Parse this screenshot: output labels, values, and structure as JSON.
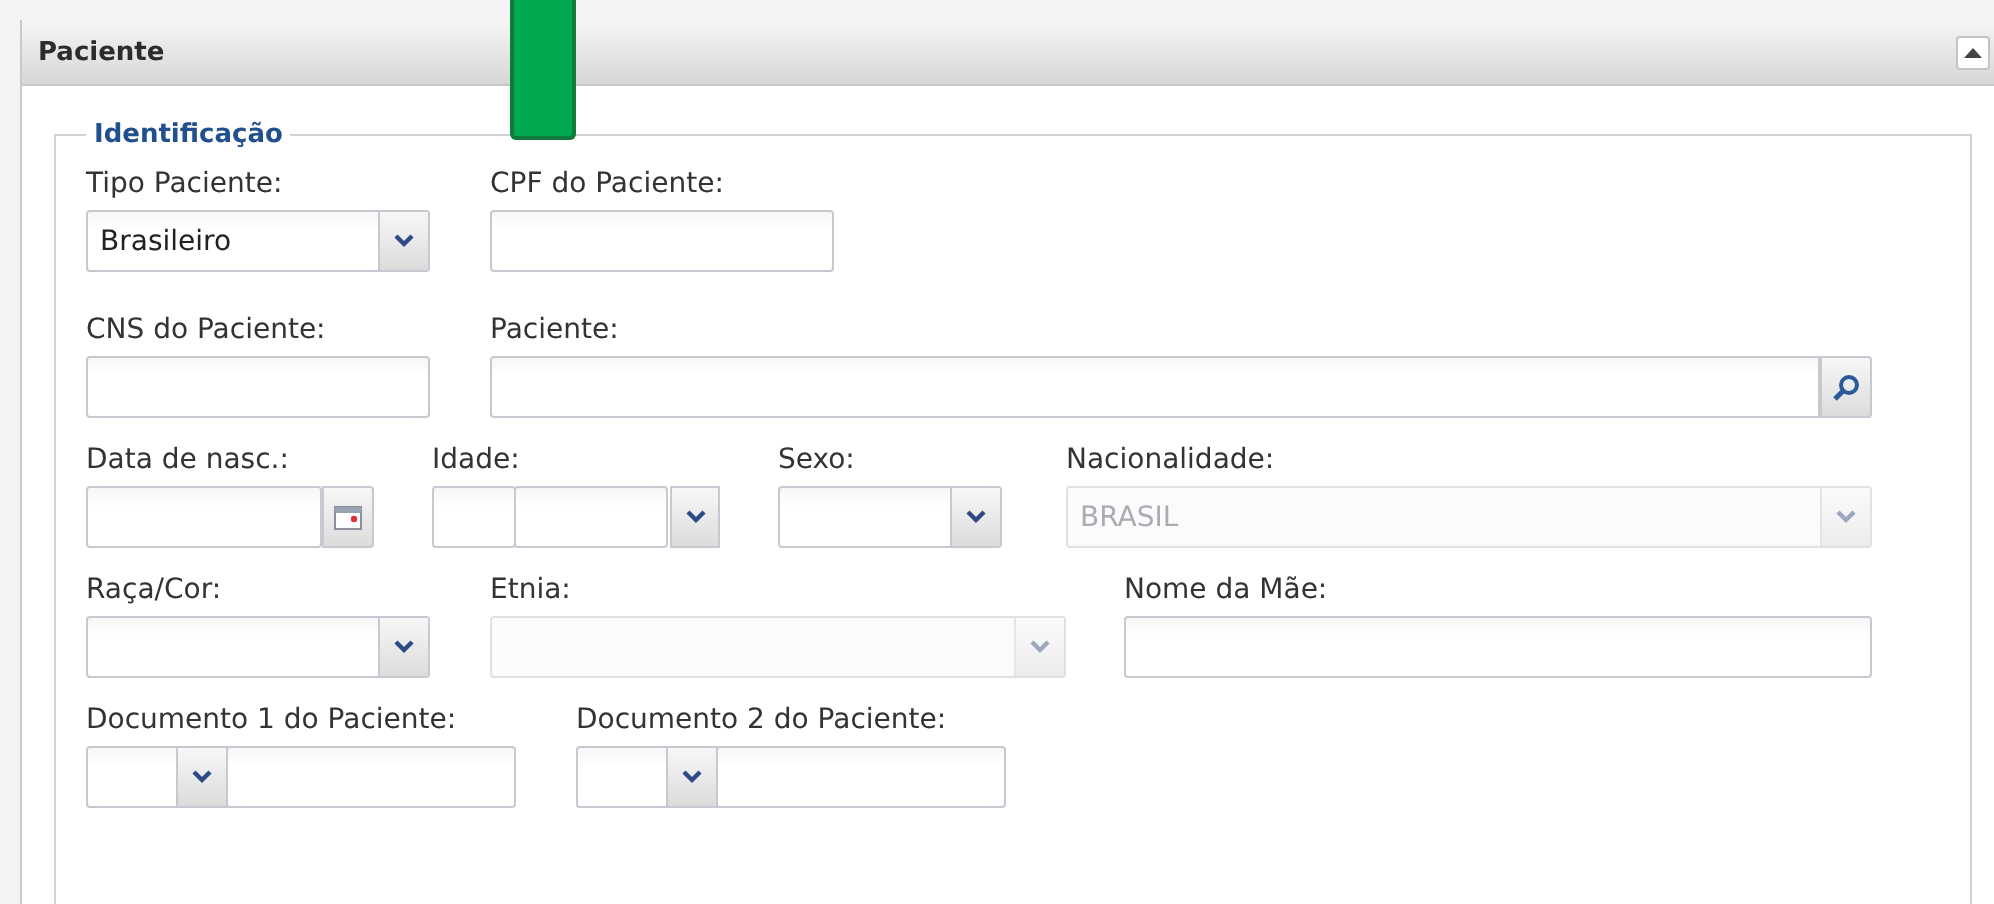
{
  "panel": {
    "title": "Paciente",
    "expanded": true,
    "section": {
      "title": "Identificação",
      "lines": [
        {
          "fields": [
            {
              "kind": "select",
              "label": "Tipo Paciente:",
              "value": "Brasileiro",
              "disabled": false
            },
            {
              "kind": "text",
              "label": "CPF do Paciente:"
            }
          ]
        },
        {
          "fields": [
            {
              "kind": "text",
              "label": "CNS do Paciente:"
            },
            {
              "kind": "search",
              "label": "Paciente:"
            }
          ]
        },
        {
          "fields": [
            {
              "kind": "date",
              "label": "Data de nasc.:"
            },
            {
              "kind": "age",
              "label": "Idade:"
            },
            {
              "kind": "select",
              "label": "Sexo:",
              "disabled": false
            },
            {
              "kind": "select",
              "label": "Nacionalidade:",
              "value": "BRASIL",
              "disabled": true
            }
          ]
        },
        {
          "fields": [
            {
              "kind": "select",
              "label": "Raça/Cor:",
              "disabled": false
            },
            {
              "kind": "select",
              "label": "Etnia:",
              "disabled": true
            },
            {
              "kind": "text",
              "label": "Nome da Mãe:"
            }
          ]
        },
        {
          "fields": [
            {
              "kind": "doc",
              "label": "Documento 1 do Paciente:"
            },
            {
              "kind": "doc",
              "label": "Documento 2 do Paciente:"
            }
          ]
        }
      ]
    }
  }
}
